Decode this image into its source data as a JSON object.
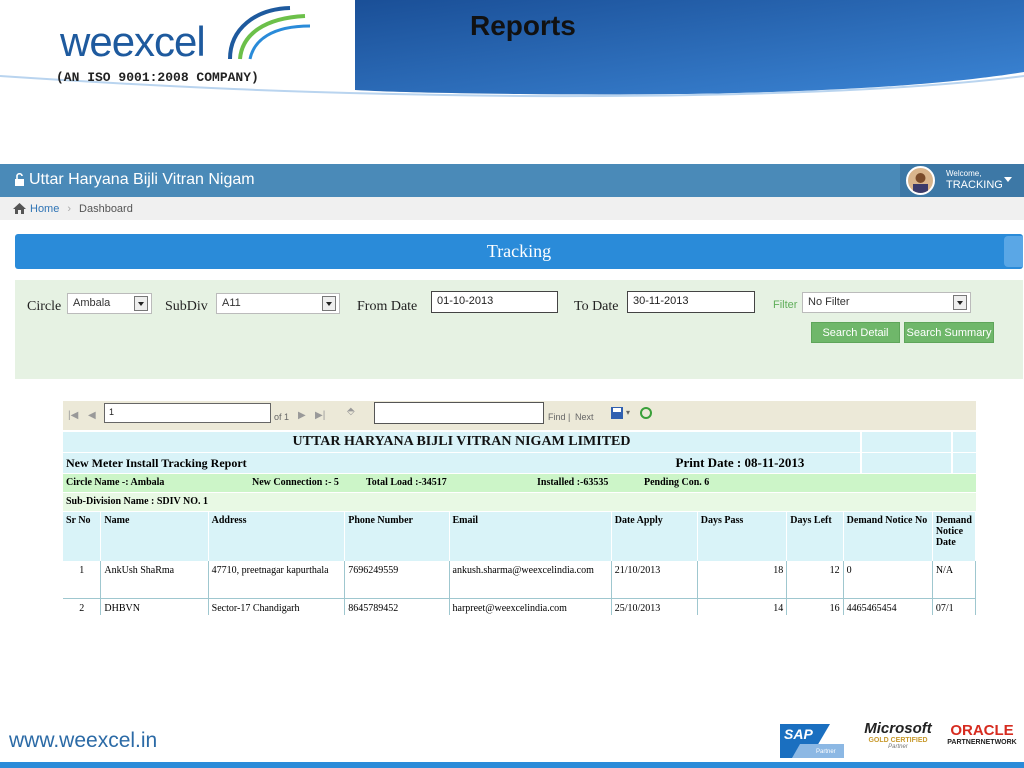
{
  "slide": {
    "brand": "weexcel",
    "iso": "(AN ISO 9001:2008 COMPANY)",
    "title": "Reports",
    "footer_url": "www.weexcel.in",
    "partner_logos": {
      "sap": "SAP",
      "sap_sub": "Partner",
      "ms_main": "Microsoft",
      "ms_sub": "GOLD CERTIFIED",
      "ms_partner": "Partner",
      "oracle": "ORACLE",
      "oracle_sub": "PARTNERNETWORK"
    }
  },
  "app": {
    "title": "Uttar Haryana Bijli Vitran Nigam",
    "user_welcome": "Welcome,",
    "user_name": "TRACKING"
  },
  "breadcrumb": {
    "home": "Home",
    "current": "Dashboard"
  },
  "banner": {
    "title": "Tracking"
  },
  "filters": {
    "circle_label": "Circle",
    "circle_value": "Ambala",
    "subdiv_label": "SubDiv",
    "subdiv_value": "A11",
    "from_label": "From Date",
    "from_value": "01-10-2013",
    "to_label": "To Date",
    "to_value": "30-11-2013",
    "filter_label": "Filter",
    "filter_value": "No Filter",
    "search_detail": "Search Detail",
    "search_summary": "Search Summary"
  },
  "toolbar": {
    "page_value": "1",
    "of_pages": "of 1",
    "find": "Find",
    "sep": "|",
    "next": "Next"
  },
  "report": {
    "org": "UTTAR HARYANA BIJLI VITRAN NIGAM LIMITED",
    "subtitle": "New Meter Install Tracking Report",
    "print_date": "Print Date : 08-11-2013",
    "circle_name": "Circle Name -: Ambala",
    "new_connection": "New Connection :- 5",
    "total_load": "Total Load :-34517",
    "installed": "Installed :-63535",
    "pending": "Pending Con. 6",
    "subdivision": "Sub-Division Name : SDIV NO. 1",
    "columns": [
      "Sr No",
      "Name",
      "Address",
      "Phone Number",
      "Email",
      "Date Apply",
      "Days Pass",
      "Days Left",
      "Demand Notice No",
      "Demand Notice Date"
    ],
    "rows": [
      [
        "1",
        "AnkUsh ShaRma",
        "47710, preetnagar kapurthala",
        "7696249559",
        "ankush.sharma@weexcelindia.com",
        "21/10/2013",
        "18",
        "12",
        "0",
        "N/A"
      ],
      [
        "2",
        "DHBVN",
        "Sector-17 Chandigarh",
        "8645789452",
        "harpreet@weexcelindia.com",
        "25/10/2013",
        "14",
        "16",
        "4465465454",
        "07/1"
      ]
    ]
  }
}
